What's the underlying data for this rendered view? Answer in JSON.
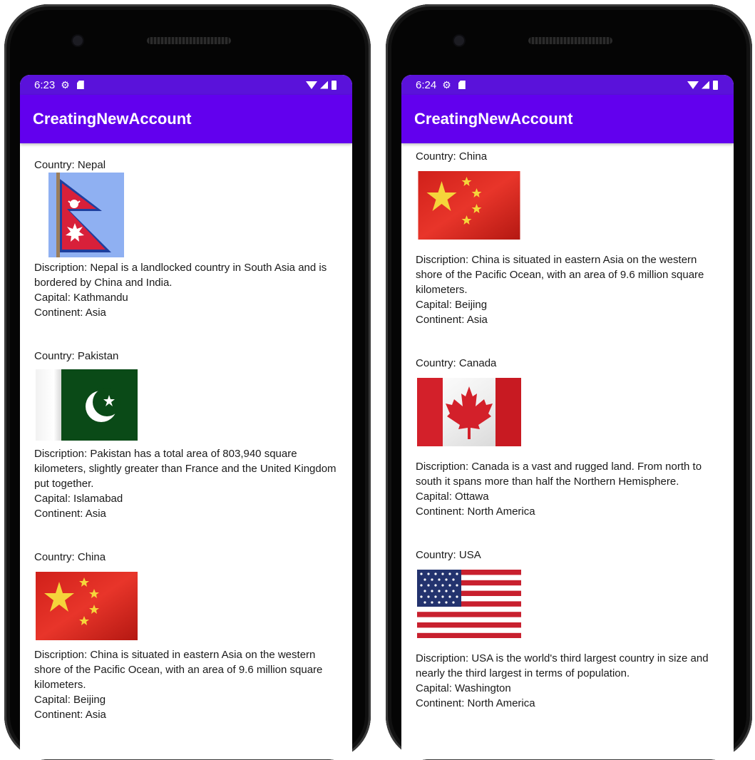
{
  "left_phone": {
    "status": {
      "time": "6:23"
    },
    "app_title": "CreatingNewAccount",
    "items": [
      {
        "country": "Country: Nepal",
        "flag": "nepal-flag",
        "description": "Discription: Nepal is a landlocked country in South Asia and is bordered by China and India.",
        "capital": "Capital: Kathmandu",
        "continent": "Continent: Asia"
      },
      {
        "country": "Country: Pakistan",
        "flag": "pakistan-flag",
        "description": "Discription: Pakistan has a total area of 803,940 square kilometers, slightly greater than France and the United Kingdom put together.",
        "capital": "Capital: Islamabad",
        "continent": "Continent:  Asia"
      },
      {
        "country": "Country: China",
        "flag": "china-flag",
        "description": "Discription: China is situated in eastern Asia on the western shore of the Pacific Ocean, with an area of 9.6 million square kilometers.",
        "capital": "Capital: Beijing",
        "continent": "Continent: Asia"
      }
    ]
  },
  "right_phone": {
    "status": {
      "time": "6:24"
    },
    "app_title": "CreatingNewAccount",
    "items": [
      {
        "country": "Country: China",
        "flag": "china-flag",
        "description": "Discription: China is situated in eastern Asia on the western shore of the Pacific Ocean, with an area of 9.6 million square kilometers.",
        "capital": "Capital: Beijing",
        "continent": "Continent: Asia"
      },
      {
        "country": "Country: Canada",
        "flag": "canada-flag",
        "description": "Discription: Canada is a vast and rugged land. From north to south it spans more than half the Northern Hemisphere.",
        "capital": "Capital: Ottawa",
        "continent": "Continent: North America"
      },
      {
        "country": "Country: USA",
        "flag": "usa-flag",
        "description": "Discription: USA is the world's third largest country in size and nearly the third largest in terms of population.",
        "capital": "Capital: Washington",
        "continent": "Continent: North America"
      }
    ]
  },
  "colors": {
    "status_bar": "#5a12da",
    "app_bar": "#6200ee",
    "text": "#1a1a1a"
  }
}
